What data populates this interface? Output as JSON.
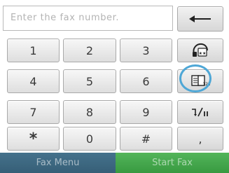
{
  "fax_input": {
    "placeholder": "Enter the fax number."
  },
  "keypad": {
    "rows": [
      [
        "1",
        "2",
        "3"
      ],
      [
        "4",
        "5",
        "6"
      ],
      [
        "7",
        "8",
        "9"
      ],
      [
        "*",
        "0",
        "#"
      ]
    ],
    "comma": ","
  },
  "function_keys": {
    "backspace_icon": "arrow-left-icon",
    "speed_dial_icon": "phone-book-icon",
    "phone_book_icon": "address-book-123-icon",
    "redial_pause_icon": "redial-pause-icon"
  },
  "bottom_bar": {
    "fax_menu_label": "Fax Menu",
    "start_fax_label": "Start Fax"
  },
  "colors": {
    "fax_menu": "#2f5a74",
    "start_fax": "#3aa244",
    "highlight_ring": "#4ea7d6"
  }
}
